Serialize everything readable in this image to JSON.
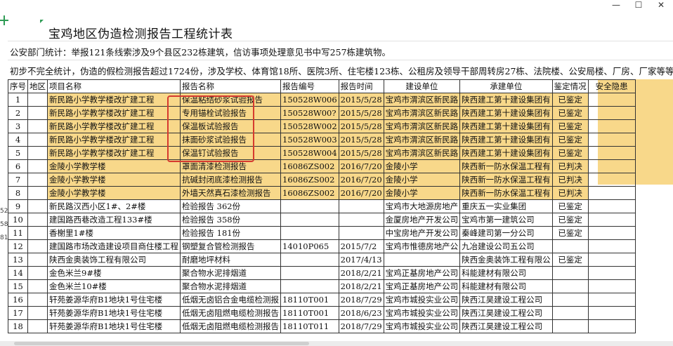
{
  "window": {
    "minimize": "—",
    "maximize": "☐",
    "close": "✕"
  },
  "sheet": {
    "title": "宝鸡地区伪造检测报告工程统计表",
    "line1": "公安部门统计：举报121条线索涉及9个县区232栋建筑，信访事项处理意见书中写257栋建筑物。",
    "line2": "初步不完全统计，伪造的假检测报告超过1724份，涉及学校、体育馆18所、医院3所、住宅楼123栋、公租房及领导干部周转房27栋、法院楼、公安局楼、厂房、厂家等等",
    "left_row_numbers": [
      "52",
      "58",
      "81"
    ],
    "headers": [
      "序号",
      "地区",
      "项目名称",
      "报告名称",
      "报告编号",
      "报告时间",
      "建设单位",
      "承建单位",
      "鉴定情况",
      "安全隐患"
    ],
    "rows": [
      {
        "idx": "1",
        "project": "新民路小学教学楼改扩建工程",
        "report": "保温粘结砂浆试验报告",
        "num": "150528W006",
        "date": "2015/5/28",
        "owner": "宝鸡市渭滨区新民路",
        "builder": "陕西建工第十建设集团有",
        "status": "已鉴定",
        "yellow": true
      },
      {
        "idx": "2",
        "project": "新民路小学教学楼改扩建工程",
        "report": "专用锚栓试验报告",
        "num": "150528W00?",
        "date": "2015/5/28",
        "owner": "宝鸡市渭滨区新民路",
        "builder": "陕西建工第十建设集团有",
        "status": "已鉴定",
        "yellow": true
      },
      {
        "idx": "3",
        "project": "新民路小学教学楼改扩建工程",
        "report": "保温板试验报告",
        "num": "150528W002",
        "date": "2015/5/28",
        "owner": "宝鸡市渭滨区新民路",
        "builder": "陕西建工第十建设集团有",
        "status": "已鉴定",
        "yellow": true
      },
      {
        "idx": "4",
        "project": "新民路小学教学楼改扩建工程",
        "report": "抹面砂浆试验报告",
        "num": "150528W003",
        "date": "2015/5/28",
        "owner": "宝鸡市渭滨区新民路",
        "builder": "陕西建工第十建设集团有",
        "status": "已鉴定",
        "yellow": true
      },
      {
        "idx": "5",
        "project": "新民路小学教学楼改扩建工程",
        "report": "保温钉试验报告",
        "num": "150528W004",
        "date": "2015/5/28",
        "owner": "宝鸡市渭滨区新民路",
        "builder": "陕西建工第十建设集团有",
        "status": "已鉴定",
        "yellow": true
      },
      {
        "idx": "6",
        "project": "金陵小学教学楼",
        "report": "罩面清漆检测报告",
        "num": "16086ZS002",
        "date": "2016/7/20",
        "owner": "金陵小学",
        "builder": "陕西新一防水保温工程有",
        "status": "已判决",
        "yellow": true
      },
      {
        "idx": "7",
        "project": "金陵小学教学楼",
        "report": "抗碱封闭底漆检测报告",
        "num": "16086ZS002",
        "date": "2016/7/20",
        "owner": "金陵小学",
        "builder": "陕西新一防水保温工程有",
        "status": "已判决",
        "yellow": true
      },
      {
        "idx": "8",
        "project": "金陵小学教学楼",
        "report": "外墙天然真石漆检测报告",
        "num": "16086ZS002",
        "date": "2016/7/20",
        "owner": "金陵小学",
        "builder": "陕西新一防水保温工程有",
        "status": "已判决",
        "yellow": true
      },
      {
        "idx": "9",
        "project": "新民路汉西小区1#、2#楼",
        "report": "检验报告 362份",
        "num": "",
        "date": "",
        "owner": "宝鸡市大地源房地产",
        "builder": "重庆五一实业集团",
        "status": "已鉴定",
        "yellow": false
      },
      {
        "idx": "10",
        "project": "建国路西巷改造工程133#楼",
        "report": "检验报告 358份",
        "num": "",
        "date": "",
        "owner": "金厦房地产开发公司",
        "builder": "宝鸡市第一建筑公司",
        "status": "已鉴定",
        "yellow": false
      },
      {
        "idx": "11",
        "project": "香榭里1#楼",
        "report": "检验报告 181份",
        "num": "",
        "date": "",
        "owner": "中宝房地产开发公司",
        "builder": "秦峰建司第一分公司",
        "status": "已鉴定",
        "yellow": false
      },
      {
        "idx": "12",
        "project": "建国路市场改造建设项目商住楼工程",
        "report": "钢塑复合管检测报告",
        "num": "14010P065",
        "date": "2015/7/2",
        "owner": "宝鸡市惟德房地产公",
        "builder": "九冶建设公司五公司",
        "status": "",
        "yellow": false
      },
      {
        "idx": "13",
        "project": "陕西金奥装饰工程有限公司",
        "report": "耐磨地坪材料",
        "num": "",
        "date": "2017/4/13",
        "owner": "",
        "builder": "陕西金奥装饰工程有限公",
        "status": "已鉴定",
        "yellow": false
      },
      {
        "idx": "14",
        "project": "金色米兰9#楼",
        "report": "聚合物水泥排烟道",
        "num": "",
        "date": "2018/2/21",
        "owner": "宝鸡正基房地产公司",
        "builder": "科能建材有限公司",
        "status": "",
        "yellow": false
      },
      {
        "idx": "15",
        "project": "金色米兰10#楼",
        "report": "聚合物水泥排烟道",
        "num": "",
        "date": "2018/2/21",
        "owner": "宝鸡正基房地产公司",
        "builder": "科能建材有限公司",
        "status": "",
        "yellow": false
      },
      {
        "idx": "16",
        "project": "轩苑姜源华府B1地块1号住宅楼",
        "report": "低烟无卤铝合金电缆检测报",
        "num": "18110T001",
        "date": "2018/7/29",
        "owner": "宝鸡市城投实业公司",
        "builder": "陕西江昊建设工程公司",
        "status": "",
        "yellow": false
      },
      {
        "idx": "17",
        "project": "轩苑姜源华府B1地块1号住宅楼",
        "report": "低烟无卤阻燃电缆检测报告",
        "num": "18110T001",
        "date": "2018/6/23",
        "owner": "宝鸡市城投实业公司",
        "builder": "陕西江昊建设工程公司",
        "status": "",
        "yellow": false
      },
      {
        "idx": "18",
        "project": "轩苑姜源华府B1地块1号住宅楼",
        "report": "低烟无卤阻燃电缆检测报告",
        "num": "18110T011",
        "date": "2018/7/29",
        "owner": "宝鸡市城投实业公司",
        "builder": "陕西江昊建设工程公司",
        "status": "",
        "yellow": false
      }
    ]
  },
  "colors": {
    "highlight_yellow": "#f8d88a",
    "annotation_red": "#d63a2f",
    "marker_green": "#2f9c55"
  }
}
